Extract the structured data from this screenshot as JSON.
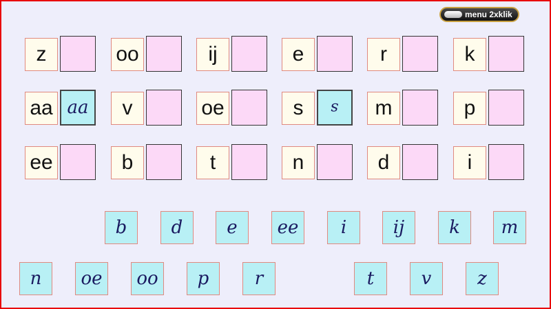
{
  "menu": {
    "label": "menu 2xklik"
  },
  "rows": [
    [
      {
        "letter": "z",
        "slot": ""
      },
      {
        "letter": "oo",
        "slot": ""
      },
      {
        "letter": "ij",
        "slot": ""
      },
      {
        "letter": "e",
        "slot": ""
      },
      {
        "letter": "r",
        "slot": ""
      },
      {
        "letter": "k",
        "slot": ""
      }
    ],
    [
      {
        "letter": "aa",
        "slot": "aa"
      },
      {
        "letter": "v",
        "slot": ""
      },
      {
        "letter": "oe",
        "slot": ""
      },
      {
        "letter": "s",
        "slot": "s"
      },
      {
        "letter": "m",
        "slot": ""
      },
      {
        "letter": "p",
        "slot": ""
      }
    ],
    [
      {
        "letter": "ee",
        "slot": ""
      },
      {
        "letter": "b",
        "slot": ""
      },
      {
        "letter": "t",
        "slot": ""
      },
      {
        "letter": "n",
        "slot": ""
      },
      {
        "letter": "d",
        "slot": ""
      },
      {
        "letter": "i",
        "slot": ""
      }
    ]
  ],
  "tiles_row1": [
    "b",
    "d",
    "e",
    "ee",
    "i",
    "ij",
    "k",
    "m"
  ],
  "tiles_row2": [
    "n",
    "oe",
    "oo",
    "p",
    "r",
    "t",
    "v",
    "z"
  ],
  "colors": {
    "frame": "#e8000a",
    "background": "#eeeefb",
    "print_card": "#fffcec",
    "empty_slot": "#fcd9f7",
    "tile": "#b8f0f5"
  }
}
